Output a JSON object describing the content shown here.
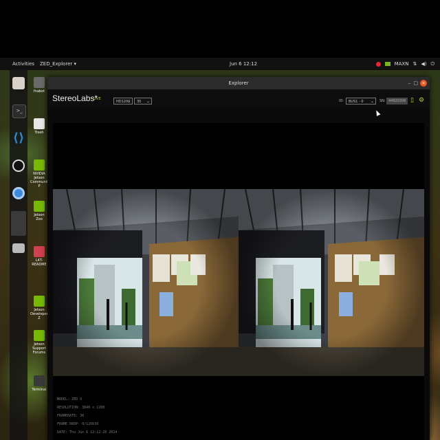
{
  "topbar": {
    "activities": "Activities",
    "app_menu": "ZED_Explorer ▾",
    "clock": "Jun 6  12:12",
    "power_mode": "MAXN",
    "tray_icons": [
      "nvidia-icon",
      "network-icon",
      "volume-icon",
      "power-icon"
    ]
  },
  "dock": {
    "apps": [
      "files-icon",
      "terminal-icon",
      "vscode-icon",
      "obs-icon",
      "chromium-icon",
      "workspace-icon",
      "drive-icon"
    ]
  },
  "desktop": {
    "icons": [
      {
        "label": "fnabot",
        "icon": "home-folder-icon"
      },
      {
        "label": "Trash",
        "icon": "trash-icon"
      },
      {
        "label": "NVIDIA Jetson Community P",
        "icon": "nvidia-icon"
      },
      {
        "label": "Jetson Zoo",
        "icon": "nvidia-icon"
      },
      {
        "label": "L4T-README",
        "icon": "drive-icon"
      },
      {
        "label": "Jetson Developer Z",
        "icon": "nvidia-icon"
      },
      {
        "label": "Jetson Support Forums",
        "icon": "nvidia-icon"
      },
      {
        "label": "Terminal",
        "icon": "terminal-icon"
      }
    ]
  },
  "window": {
    "title": "Explorer",
    "brand": "StereoLabs*",
    "status": "LIVE",
    "resolution_select": "HD1200",
    "fps_select": "30",
    "id_label": "ID:",
    "id_select": "BUS1 - 0",
    "sn_label": "SN:",
    "sn_value": "44820306",
    "colors": {
      "accent": "#9ad03c",
      "close": "#e95420"
    }
  },
  "info": {
    "model": "MODEL: ZED X",
    "resolution": "RESOLUTION: 3840 x 1200",
    "framerate": "FRAMERATE: 30",
    "frame_drop": "FRAME DROP: 0/126630",
    "date": "DATE: Thu Jun 6 12:12:20 2024"
  }
}
